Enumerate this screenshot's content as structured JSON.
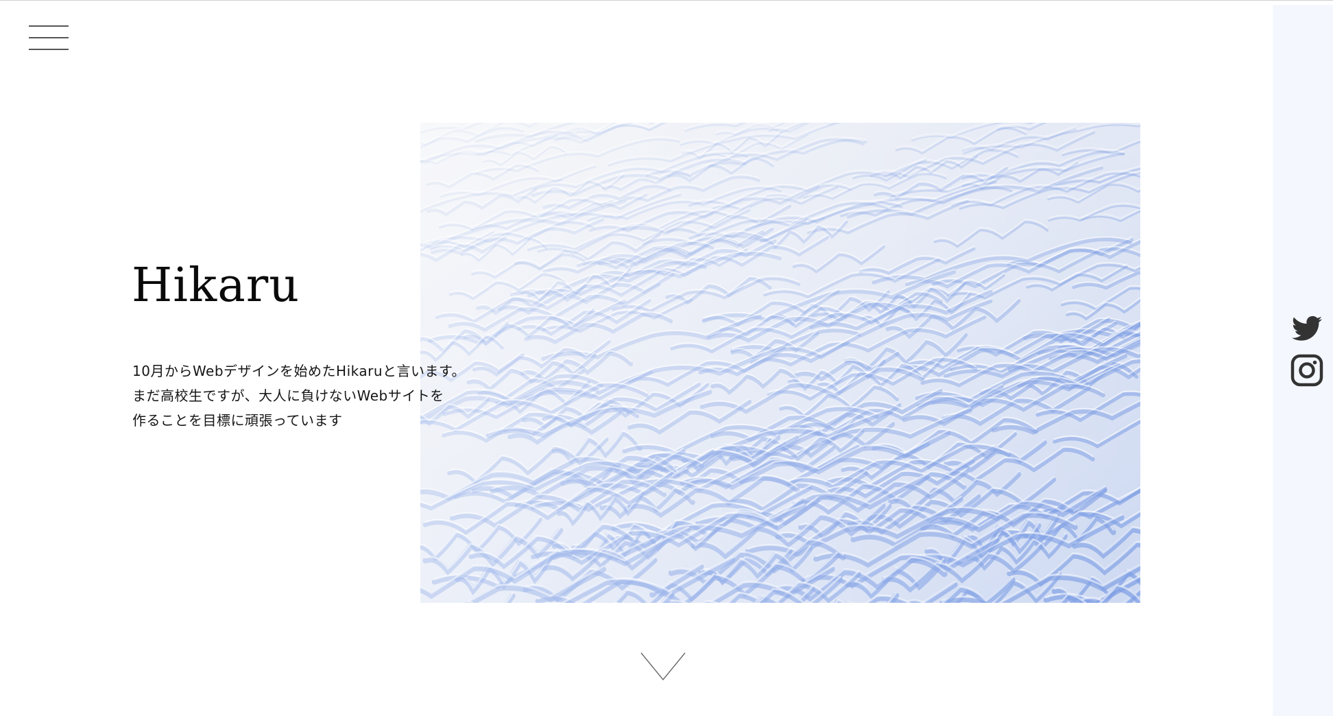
{
  "header": {
    "menu_icon": "hamburger-menu-icon"
  },
  "hero": {
    "name": "Hikaru",
    "intro_lines": [
      "10月からWebデザインを始めたHikaruと言います。",
      "まだ高校生ですが、大人に負けないWebサイトを",
      "作ることを目標に頑張っています"
    ],
    "photo": "snow-drift-photo"
  },
  "scroll_indicator": "chevron-down-icon",
  "social": [
    {
      "icon": "twitter-icon"
    },
    {
      "icon": "instagram-icon"
    }
  ],
  "colors": {
    "background": "#ffffff",
    "side_panel": "#f4f8fe",
    "text": "#111111",
    "snow_light": "#eef1f8",
    "snow_shadow": "#7f9fe4"
  }
}
